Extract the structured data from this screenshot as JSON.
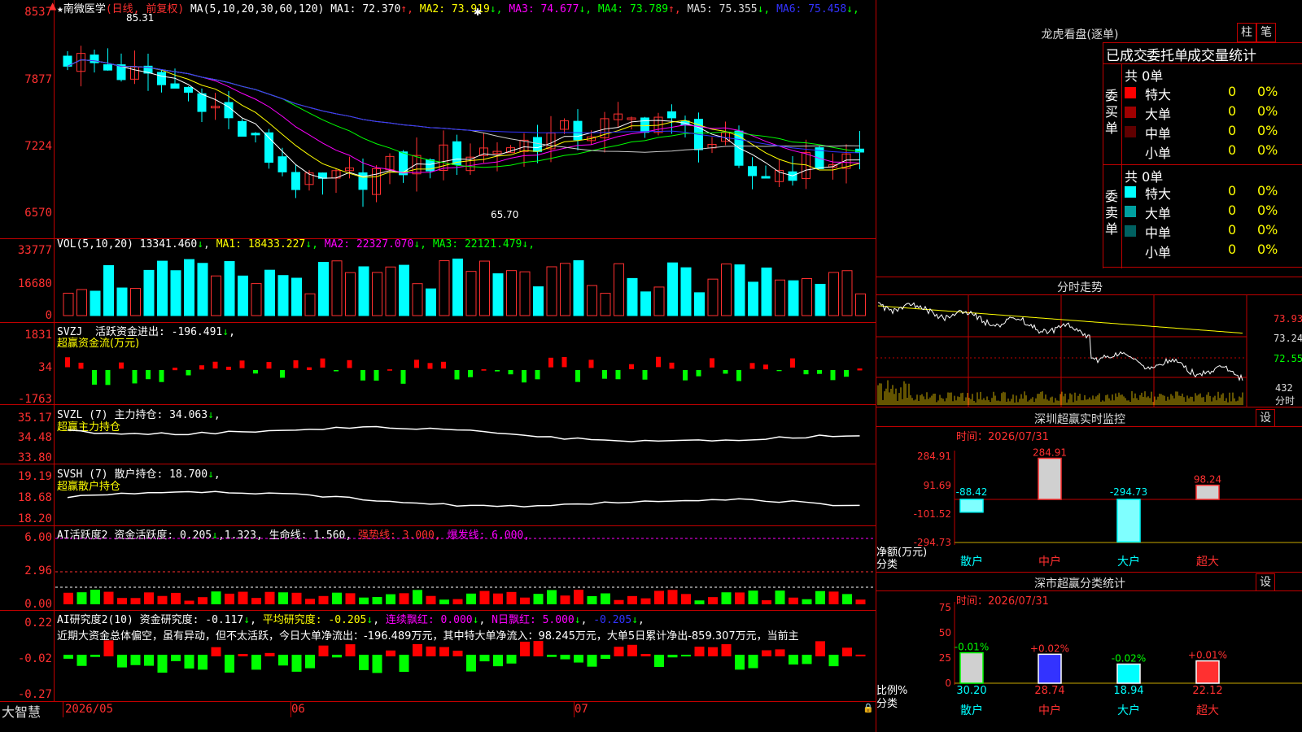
{
  "main": {
    "stock_name": "南微医学",
    "period": "(日线, 前复权)",
    "ma_header": "MA(5,10,20,30,60,120)",
    "ma": [
      {
        "label": "MA1:",
        "value": "72.370",
        "arrow": "↑",
        "color": "#ffffff"
      },
      {
        "label": "MA2:",
        "value": "73.919",
        "arrow": "↓",
        "color": "#ffff00"
      },
      {
        "label": "MA3:",
        "value": "74.677",
        "arrow": "↓",
        "color": "#ff00ff"
      },
      {
        "label": "MA4:",
        "value": "73.789",
        "arrow": "↑",
        "color": "#00ff00"
      },
      {
        "label": "MA5:",
        "value": "75.355",
        "arrow": "↓",
        "color": "#dddddd"
      },
      {
        "label": "MA6:",
        "value": "75.458",
        "arrow": "↓",
        "color": "#3333ff"
      }
    ],
    "y_labels": [
      "8537",
      "7877",
      "7224",
      "6570"
    ],
    "high_label": "85.31",
    "low_label": "65.70"
  },
  "vol": {
    "header": "VOL(5,10,20)",
    "value": "13341.460",
    "ma": [
      {
        "label": "MA1:",
        "value": "18433.227",
        "arrow": "↓",
        "color": "#ffff00"
      },
      {
        "label": "MA2:",
        "value": "22327.070",
        "arrow": "↓",
        "color": "#ff00ff"
      },
      {
        "label": "MA3:",
        "value": "22121.479",
        "arrow": "↓",
        "color": "#00ff00"
      }
    ],
    "y_labels": [
      "33777",
      "16680",
      "0"
    ]
  },
  "svzj": {
    "header": "SVZJ",
    "label": "活跃资金进出:",
    "value": "-196.491",
    "arrow": "↓",
    "subtitle": "超赢资金流(万元)",
    "y_labels": [
      "1831",
      "34",
      "-1763"
    ]
  },
  "svzl": {
    "header": "SVZL (7)",
    "label": "主力持仓:",
    "value": "34.063",
    "arrow": "↓",
    "subtitle": "超赢主力持仓",
    "y_labels": [
      "35.17",
      "34.48",
      "33.80"
    ]
  },
  "svsh": {
    "header": "SVSH (7)",
    "label": "散户持仓:",
    "value": "18.700",
    "arrow": "↓",
    "subtitle": "超赢散户持仓",
    "y_labels": [
      "19.19",
      "18.68",
      "18.20"
    ]
  },
  "ai_active": {
    "header": "AI活跃度2",
    "label1": "资金活跃度:",
    "value1": "0.205",
    "arrow1": "↓",
    "value2": "1.323",
    "label3": "生命线:",
    "value3": "1.560",
    "label4": "强势线:",
    "value4": "3.000",
    "label5": "爆发线:",
    "value5": "6.000",
    "y_labels": [
      "6.00",
      "2.96",
      "0.00"
    ]
  },
  "ai_research": {
    "header": "AI研究度2(10)",
    "label1": "资金研究度:",
    "value1": "-0.117",
    "arrow1": "↓",
    "label2": "平均研究度:",
    "value2": "-0.205",
    "arrow2": "↓",
    "label3": "连续飘红:",
    "value3": "0.000",
    "arrow3": "↓",
    "label4": "N日飘红:",
    "value4": "5.000",
    "arrow4": "↓",
    "value5": "-0.205",
    "arrow5": "↓",
    "summary": "近期大资金总体偏空，虽有异动，但不太活跃，今日大单净流出：-196.489万元，其中特大单净流入：98.245万元，大单5日累计净出-859.307万元，当前主",
    "y_labels": [
      "0.22",
      "-0.02",
      "-0.27"
    ]
  },
  "bottom": {
    "brand": "大智慧",
    "dates": [
      "2026/05",
      "06",
      "07"
    ]
  },
  "dragon": {
    "title": "龙虎看盘(逐单)",
    "btn_bar": "柱",
    "btn_stroke": "笔",
    "tabs": [
      "已成交",
      "委托单",
      "成交量统计"
    ],
    "buy_label": "委买单",
    "sell_label": "委卖单",
    "buy_total": "共 0单",
    "sell_total": "共 0单",
    "buy_rows": [
      {
        "name": "特大",
        "count": "0",
        "pct": "0%",
        "color": "#ff0000"
      },
      {
        "name": "大单",
        "count": "0",
        "pct": "0%",
        "color": "#a00000"
      },
      {
        "name": "中单",
        "count": "0",
        "pct": "0%",
        "color": "#600000"
      },
      {
        "name": "小单",
        "count": "0",
        "pct": "0%",
        "color": ""
      }
    ],
    "sell_rows": [
      {
        "name": "特大",
        "count": "0",
        "pct": "0%",
        "color": "#00ffff"
      },
      {
        "name": "大单",
        "count": "0",
        "pct": "0%",
        "color": "#00a0a0"
      },
      {
        "name": "中单",
        "count": "0",
        "pct": "0%",
        "color": "#006060"
      },
      {
        "name": "小单",
        "count": "0",
        "pct": "0%",
        "color": ""
      }
    ]
  },
  "intraday": {
    "title": "分时走势",
    "y_labels": [
      "73.93",
      "73.24",
      "72.55"
    ],
    "vol_label": "432",
    "vol_unit": "分时"
  },
  "monitor": {
    "title": "深圳超赢实时监控",
    "setting": "设",
    "time": "时间：2026/07/31",
    "y_labels": [
      "284.91",
      "91.69",
      "-101.52",
      "-294.73"
    ],
    "unit1": "净额(万元)",
    "unit2": "分类",
    "categories": [
      "散户",
      "中户",
      "大户",
      "超大"
    ],
    "values": [
      -88.42,
      284.91,
      -294.73,
      98.24
    ],
    "value_labels": [
      "-88.42",
      "284.91",
      "-294.73",
      "98.24"
    ]
  },
  "stats": {
    "title": "深市超赢分类统计",
    "setting": "设",
    "time": "时间：2026/07/31",
    "y_labels": [
      "75",
      "50",
      "25",
      "0"
    ],
    "unit1": "比例%",
    "unit2": "分类",
    "categories": [
      "散户",
      "中户",
      "大户",
      "超大"
    ],
    "values": [
      30.2,
      28.74,
      18.94,
      22.12
    ],
    "value_labels": [
      "30.20",
      "28.74",
      "18.94",
      "22.12"
    ],
    "change_labels": [
      "-0.01%",
      "+0.02%",
      "-0.02%",
      "+0.01%"
    ]
  },
  "chart_data": {
    "type": "bar",
    "title": "深圳超赢实时监控",
    "categories": [
      "散户",
      "中户",
      "大户",
      "超大"
    ],
    "values": [
      -88.42,
      284.91,
      -294.73,
      98.24
    ],
    "ylabel": "净额(万元)",
    "ylim": [
      -294.73,
      284.91
    ]
  }
}
